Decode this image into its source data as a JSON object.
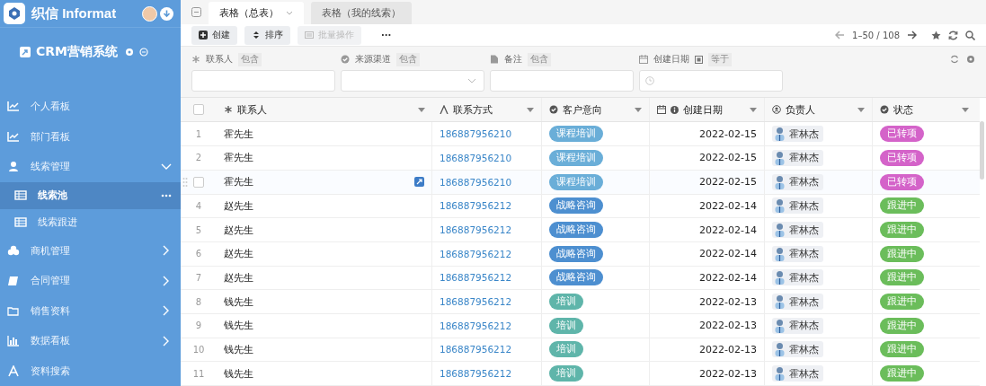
{
  "brand": {
    "name": "织信 Informat"
  },
  "app": {
    "title": "CRM营销系统"
  },
  "sidebar": {
    "items": [
      {
        "label": "个人看板",
        "selected": false
      },
      {
        "label": "部门看板",
        "selected": false
      },
      {
        "label": "线索管理",
        "selected": false,
        "expanded": true,
        "children": [
          {
            "label": "线索池",
            "selected": true
          },
          {
            "label": "线索跟进",
            "selected": false
          }
        ]
      },
      {
        "label": "商机管理",
        "selected": false,
        "expanded": false
      },
      {
        "label": "合同管理",
        "selected": false,
        "expanded": false
      },
      {
        "label": "销售资料",
        "selected": false,
        "expanded": false
      },
      {
        "label": "数据看板",
        "selected": false,
        "expanded": false
      },
      {
        "label": "资料搜索",
        "selected": false
      }
    ]
  },
  "tabs": [
    {
      "label": "表格（总表）",
      "selected": true
    },
    {
      "label": "表格（我的线索）",
      "selected": false
    }
  ],
  "toolbar": {
    "buttons": [
      {
        "label": "创建",
        "kind": "plus",
        "disabled": false
      },
      {
        "label": "排序",
        "kind": "sort",
        "disabled": false
      },
      {
        "label": "批量操作",
        "kind": "batch",
        "disabled": true
      },
      {
        "label": "···",
        "kind": "more",
        "disabled": false
      }
    ],
    "pagination": "1–50 / 108"
  },
  "filters": [
    {
      "label": "联系人",
      "op": "包含",
      "kind": "text"
    },
    {
      "label": "来源渠道",
      "op": "包含",
      "kind": "select"
    },
    {
      "label": "备注",
      "op": "包含",
      "kind": "text"
    },
    {
      "label": "创建日期",
      "op": "等于",
      "kind": "date"
    }
  ],
  "table": {
    "all_checked": false,
    "columns": [
      "联系人",
      "联系方式",
      "客户意向",
      "创建日期",
      "负责人",
      "状态"
    ],
    "rows": [
      {
        "number": "1",
        "hovered": false,
        "contact": "霍先生",
        "phone": "186887956210",
        "intent": {
          "label": "课程培训",
          "color": "#6aaed8"
        },
        "date": "2022-02-15",
        "owner": "霍林杰",
        "status": {
          "label": "已转项",
          "color": "#d463c9"
        }
      },
      {
        "number": "2",
        "hovered": false,
        "contact": "霍先生",
        "phone": "186887956210",
        "intent": {
          "label": "课程培训",
          "color": "#6aaed8"
        },
        "date": "2022-02-15",
        "owner": "霍林杰",
        "status": {
          "label": "已转项",
          "color": "#d463c9"
        }
      },
      {
        "hovered": true,
        "checked": false,
        "contact": "霍先生",
        "phone": "186887956210",
        "intent": {
          "label": "课程培训",
          "color": "#6aaed8"
        },
        "date": "2022-02-15",
        "owner": "霍林杰",
        "status": {
          "label": "已转项",
          "color": "#d463c9"
        }
      },
      {
        "number": "4",
        "hovered": false,
        "contact": "赵先生",
        "phone": "186887956212",
        "intent": {
          "label": "战略咨询",
          "color": "#4d8fd0"
        },
        "date": "2022-02-14",
        "owner": "霍林杰",
        "status": {
          "label": "跟进中",
          "color": "#6bbd5b"
        }
      },
      {
        "number": "5",
        "hovered": false,
        "contact": "赵先生",
        "phone": "186887956212",
        "intent": {
          "label": "战略咨询",
          "color": "#4d8fd0"
        },
        "date": "2022-02-14",
        "owner": "霍林杰",
        "status": {
          "label": "跟进中",
          "color": "#6bbd5b"
        }
      },
      {
        "number": "6",
        "hovered": false,
        "contact": "赵先生",
        "phone": "186887956212",
        "intent": {
          "label": "战略咨询",
          "color": "#4d8fd0"
        },
        "date": "2022-02-14",
        "owner": "霍林杰",
        "status": {
          "label": "跟进中",
          "color": "#6bbd5b"
        }
      },
      {
        "number": "7",
        "hovered": false,
        "contact": "赵先生",
        "phone": "186887956212",
        "intent": {
          "label": "战略咨询",
          "color": "#4d8fd0"
        },
        "date": "2022-02-14",
        "owner": "霍林杰",
        "status": {
          "label": "跟进中",
          "color": "#6bbd5b"
        }
      },
      {
        "number": "8",
        "hovered": false,
        "contact": "钱先生",
        "phone": "186887956212",
        "intent": {
          "label": "培训",
          "color": "#5fb5aa"
        },
        "date": "2022-02-13",
        "owner": "霍林杰",
        "status": {
          "label": "跟进中",
          "color": "#6bbd5b"
        }
      },
      {
        "number": "9",
        "hovered": false,
        "contact": "钱先生",
        "phone": "186887956212",
        "intent": {
          "label": "培训",
          "color": "#5fb5aa"
        },
        "date": "2022-02-13",
        "owner": "霍林杰",
        "status": {
          "label": "跟进中",
          "color": "#6bbd5b"
        }
      },
      {
        "number": "10",
        "hovered": false,
        "contact": "钱先生",
        "phone": "186887956212",
        "intent": {
          "label": "培训",
          "color": "#5fb5aa"
        },
        "date": "2022-02-13",
        "owner": "霍林杰",
        "status": {
          "label": "跟进中",
          "color": "#6bbd5b"
        }
      },
      {
        "number": "11",
        "hovered": false,
        "contact": "钱先生",
        "phone": "186887956212",
        "intent": {
          "label": "培训",
          "color": "#5fb5aa"
        },
        "date": "2022-02-13",
        "owner": "霍林杰",
        "status": {
          "label": "跟进中",
          "color": "#6bbd5b"
        }
      }
    ]
  }
}
